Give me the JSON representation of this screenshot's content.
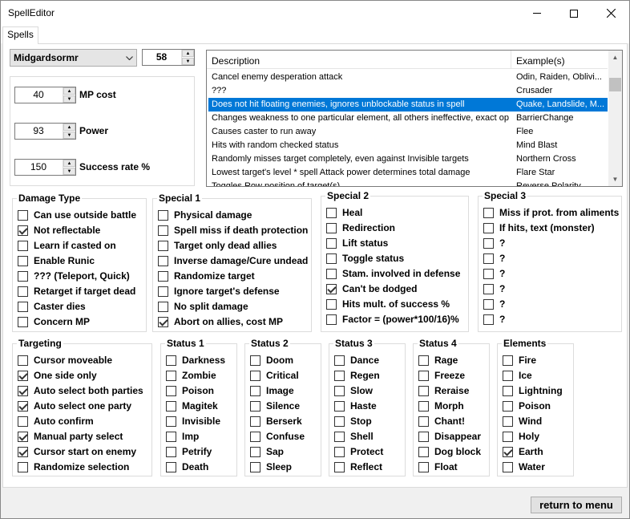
{
  "window": {
    "title": "SpellEditor"
  },
  "tabs": [
    {
      "label": "Spells"
    }
  ],
  "spell_select": {
    "value": "Midgardsormr"
  },
  "spell_index": {
    "value": "58"
  },
  "fields": [
    {
      "value": "40",
      "label": "MP cost"
    },
    {
      "value": "93",
      "label": "Power"
    },
    {
      "value": "150",
      "label": "Success rate %"
    }
  ],
  "special_list": {
    "headers": {
      "description": "Description",
      "examples": "Example(s)"
    },
    "rows": [
      {
        "description": "Cancel enemy desperation attack",
        "examples": "Odin, Raiden, Oblivi...",
        "selected": false
      },
      {
        "description": "???",
        "examples": "Crusader",
        "selected": false
      },
      {
        "description": "Does not hit floating enemies, ignores unblockable status in spell",
        "examples": "Quake, Landslide, M...",
        "selected": true
      },
      {
        "description": "Changes weakness to one particular element, all others ineffective, exact op...",
        "examples": "BarrierChange",
        "selected": false
      },
      {
        "description": "Causes caster to run away",
        "examples": "Flee",
        "selected": false
      },
      {
        "description": "Hits with random checked status",
        "examples": "Mind Blast",
        "selected": false
      },
      {
        "description": "Randomly misses target completely, even against Invisible targets",
        "examples": "Northern Cross",
        "selected": false
      },
      {
        "description": "Lowest target's level * spell Attack power determines total damage",
        "examples": "Flare Star",
        "selected": false
      },
      {
        "description": "Toggles Row position of target(s)",
        "examples": "Reverse Polarity",
        "selected": false
      }
    ]
  },
  "groups": {
    "damage_type": {
      "title": "Damage Type",
      "items": [
        {
          "label": "Can use outside battle",
          "checked": false
        },
        {
          "label": "Not reflectable",
          "checked": true
        },
        {
          "label": "Learn if casted on",
          "checked": false
        },
        {
          "label": "Enable Runic",
          "checked": false
        },
        {
          "label": "??? (Teleport, Quick)",
          "checked": false
        },
        {
          "label": "Retarget if target dead",
          "checked": false
        },
        {
          "label": "Caster dies",
          "checked": false
        },
        {
          "label": "Concern MP",
          "checked": false
        }
      ]
    },
    "special1": {
      "title": "Special 1",
      "items": [
        {
          "label": "Physical damage",
          "checked": false
        },
        {
          "label": "Spell miss if death protection",
          "checked": false
        },
        {
          "label": "Target only dead allies",
          "checked": false
        },
        {
          "label": "Inverse damage/Cure undead",
          "checked": false
        },
        {
          "label": "Randomize target",
          "checked": false
        },
        {
          "label": "Ignore target's defense",
          "checked": false
        },
        {
          "label": "No split damage",
          "checked": false
        },
        {
          "label": "Abort on allies, cost MP",
          "checked": true
        }
      ]
    },
    "special2": {
      "title": "Special 2",
      "items": [
        {
          "label": "Heal",
          "checked": false
        },
        {
          "label": "Redirection",
          "checked": false
        },
        {
          "label": "Lift status",
          "checked": false
        },
        {
          "label": "Toggle status",
          "checked": false
        },
        {
          "label": "Stam. involved in defense",
          "checked": false
        },
        {
          "label": "Can't be dodged",
          "checked": true
        },
        {
          "label": "Hits mult. of success %",
          "checked": false
        },
        {
          "label": "Factor = (power*100/16)%",
          "checked": false
        }
      ]
    },
    "special3": {
      "title": "Special 3",
      "items": [
        {
          "label": "Miss if prot. from aliments",
          "checked": false
        },
        {
          "label": "If hits, text (monster)",
          "checked": false
        },
        {
          "label": "?",
          "checked": false
        },
        {
          "label": "?",
          "checked": false
        },
        {
          "label": "?",
          "checked": false
        },
        {
          "label": "?",
          "checked": false
        },
        {
          "label": "?",
          "checked": false
        },
        {
          "label": "?",
          "checked": false
        }
      ]
    },
    "targeting": {
      "title": "Targeting",
      "items": [
        {
          "label": "Cursor moveable",
          "checked": false
        },
        {
          "label": "One side only",
          "checked": true
        },
        {
          "label": "Auto select both parties",
          "checked": true
        },
        {
          "label": "Auto select one party",
          "checked": true
        },
        {
          "label": "Auto confirm",
          "checked": false
        },
        {
          "label": "Manual party select",
          "checked": true
        },
        {
          "label": "Cursor start on enemy",
          "checked": true
        },
        {
          "label": "Randomize selection",
          "checked": false
        }
      ]
    },
    "status1": {
      "title": "Status 1",
      "items": [
        {
          "label": "Darkness",
          "checked": false
        },
        {
          "label": "Zombie",
          "checked": false
        },
        {
          "label": "Poison",
          "checked": false
        },
        {
          "label": "Magitek",
          "checked": false
        },
        {
          "label": "Invisible",
          "checked": false
        },
        {
          "label": "Imp",
          "checked": false
        },
        {
          "label": "Petrify",
          "checked": false
        },
        {
          "label": "Death",
          "checked": false
        }
      ]
    },
    "status2": {
      "title": "Status 2",
      "items": [
        {
          "label": "Doom",
          "checked": false
        },
        {
          "label": "Critical",
          "checked": false
        },
        {
          "label": "Image",
          "checked": false
        },
        {
          "label": "Silence",
          "checked": false
        },
        {
          "label": "Berserk",
          "checked": false
        },
        {
          "label": "Confuse",
          "checked": false
        },
        {
          "label": "Sap",
          "checked": false
        },
        {
          "label": "Sleep",
          "checked": false
        }
      ]
    },
    "status3": {
      "title": "Status 3",
      "items": [
        {
          "label": "Dance",
          "checked": false
        },
        {
          "label": "Regen",
          "checked": false
        },
        {
          "label": "Slow",
          "checked": false
        },
        {
          "label": "Haste",
          "checked": false
        },
        {
          "label": "Stop",
          "checked": false
        },
        {
          "label": "Shell",
          "checked": false
        },
        {
          "label": "Protect",
          "checked": false
        },
        {
          "label": "Reflect",
          "checked": false
        }
      ]
    },
    "status4": {
      "title": "Status 4",
      "items": [
        {
          "label": "Rage",
          "checked": false
        },
        {
          "label": "Freeze",
          "checked": false
        },
        {
          "label": "Reraise",
          "checked": false
        },
        {
          "label": "Morph",
          "checked": false
        },
        {
          "label": "Chant!",
          "checked": false
        },
        {
          "label": "Disappear",
          "checked": false
        },
        {
          "label": "Dog block",
          "checked": false
        },
        {
          "label": "Float",
          "checked": false
        }
      ]
    },
    "elements": {
      "title": "Elements",
      "items": [
        {
          "label": "Fire",
          "checked": false
        },
        {
          "label": "Ice",
          "checked": false
        },
        {
          "label": "Lightning",
          "checked": false
        },
        {
          "label": "Poison",
          "checked": false
        },
        {
          "label": "Wind",
          "checked": false
        },
        {
          "label": "Holy",
          "checked": false
        },
        {
          "label": "Earth",
          "checked": true
        },
        {
          "label": "Water",
          "checked": false
        }
      ]
    }
  },
  "footer": {
    "return_label": "return to menu"
  }
}
